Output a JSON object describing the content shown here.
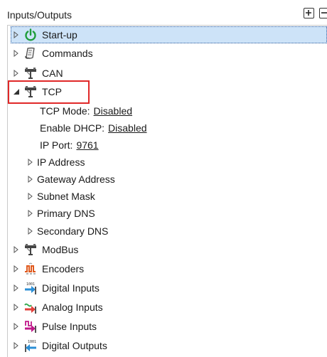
{
  "panel": {
    "title": "Inputs/Outputs",
    "expand_all_icon": "plus-box-icon",
    "collapse_all_icon": "minus-box-icon"
  },
  "tree": {
    "startup": {
      "label": "Start-up",
      "icon": "power-icon",
      "color": "#1f9d3a"
    },
    "commands": {
      "label": "Commands",
      "icon": "command-scroll-icon"
    },
    "can": {
      "label": "CAN",
      "icon": "network-connector-icon"
    },
    "tcp": {
      "label": "TCP",
      "icon": "network-connector-icon",
      "tcp_mode": {
        "label": "TCP Mode:",
        "value": "Disabled"
      },
      "enable_dhcp": {
        "label": "Enable DHCP:",
        "value": "Disabled"
      },
      "ip_port": {
        "label": "IP Port:",
        "value": "9761"
      },
      "children": {
        "ip_address": "IP Address",
        "gateway_address": "Gateway Address",
        "subnet_mask": "Subnet Mask",
        "primary_dns": "Primary DNS",
        "secondary_dns": "Secondary DNS"
      }
    },
    "modbus": {
      "label": "ModBus",
      "icon": "network-connector-icon"
    },
    "encoders": {
      "label": "Encoders",
      "icon": "encoder-pulse-icon",
      "color": "#e05a1e"
    },
    "digital_inputs": {
      "label": "Digital Inputs",
      "icon": "digital-input-icon",
      "color": "#2b8fd6"
    },
    "analog_inputs": {
      "label": "Analog Inputs",
      "icon": "analog-input-icon",
      "color": "#e2403a"
    },
    "pulse_inputs": {
      "label": "Pulse Inputs",
      "icon": "pulse-input-icon",
      "color": "#c0188a"
    },
    "digital_outputs": {
      "label": "Digital Outputs",
      "icon": "digital-output-icon",
      "color": "#2b8fd6"
    }
  },
  "colors": {
    "selection_bg": "#cde3f8",
    "highlight_border": "#e02828"
  }
}
